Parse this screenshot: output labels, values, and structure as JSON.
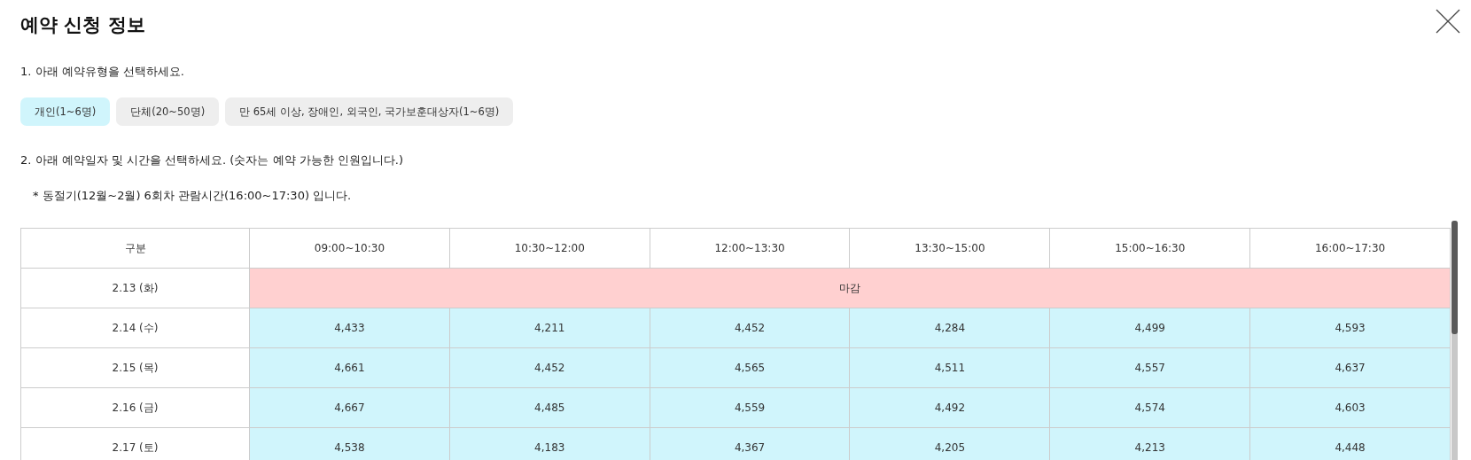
{
  "title": "예약 신청 정보",
  "step_1": "1. 아래 예약유형을 선택하세요.",
  "reservation_types": [
    {
      "label": "개인(1~6명)",
      "selected": true
    },
    {
      "label": "단체(20~50명)",
      "selected": false
    },
    {
      "label": "만 65세 이상, 장애인, 외국인, 국가보훈대상자(1~6명)",
      "selected": false
    }
  ],
  "step_2": "2. 아래 예약일자 및 시간을 선택하세요. (숫자는 예약 가능한 인원입니다.)",
  "note": "* 동절기(12월~2월) 6회차 관람시간(16:00~17:30) 입니다.",
  "table": {
    "columns": [
      "구분",
      "09:00~10:30",
      "10:30~12:00",
      "12:00~13:30",
      "13:30~15:00",
      "15:00~16:30",
      "16:00~17:30"
    ],
    "rows": [
      {
        "date": "2.13 (화)",
        "kind": "closed",
        "label": "마감"
      },
      {
        "date": "2.14 (수)",
        "kind": "open",
        "cells": [
          "4,433",
          "4,211",
          "4,452",
          "4,284",
          "4,499",
          "4,593"
        ]
      },
      {
        "date": "2.15 (목)",
        "kind": "open",
        "cells": [
          "4,661",
          "4,452",
          "4,565",
          "4,511",
          "4,557",
          "4,637"
        ]
      },
      {
        "date": "2.16 (금)",
        "kind": "open",
        "cells": [
          "4,667",
          "4,485",
          "4,559",
          "4,492",
          "4,574",
          "4,603"
        ]
      },
      {
        "date": "2.17 (토)",
        "kind": "open",
        "cells": [
          "4,538",
          "4,183",
          "4,367",
          "4,205",
          "4,213",
          "4,448"
        ]
      }
    ]
  }
}
